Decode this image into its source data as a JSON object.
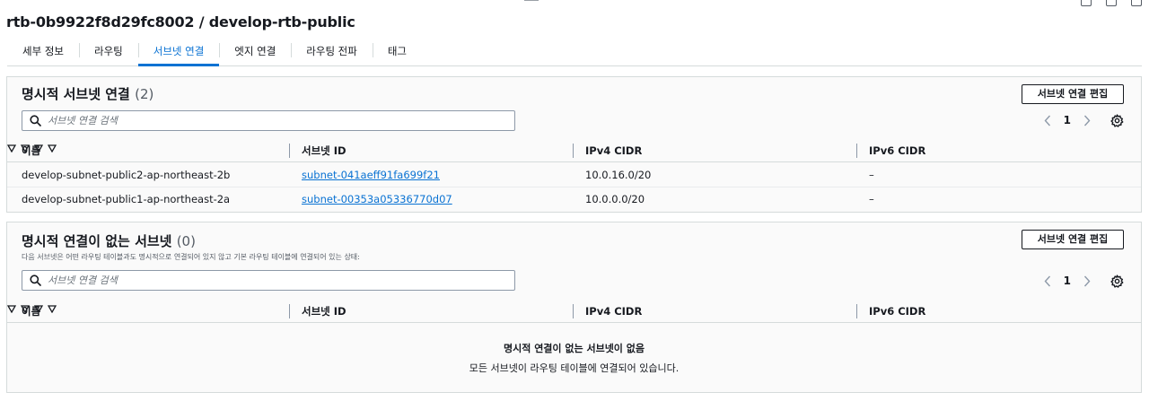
{
  "page": {
    "title": "rtb-0b9922f8d29fc8002 / develop-rtb-public"
  },
  "tabs": [
    {
      "label": "세부 정보"
    },
    {
      "label": "라우팅"
    },
    {
      "label": "서브넷 연결"
    },
    {
      "label": "엣지 연결"
    },
    {
      "label": "라우팅 전파"
    },
    {
      "label": "태그"
    }
  ],
  "explicit": {
    "title": "명시적 서브넷 연결",
    "count": "(2)",
    "edit_label": "서브넷 연결 편집",
    "search_placeholder": "서브넷 연결 검색",
    "page": "1",
    "columns": [
      "이름",
      "서브넷 ID",
      "IPv4 CIDR",
      "IPv6 CIDR"
    ],
    "rows": [
      {
        "name": "develop-subnet-public2-ap-northeast-2b",
        "subnet_id": "subnet-041aeff91fa699f21",
        "ipv4": "10.0.16.0/20",
        "ipv6": "–"
      },
      {
        "name": "develop-subnet-public1-ap-northeast-2a",
        "subnet_id": "subnet-00353a05336770d07",
        "ipv4": "10.0.0.0/20",
        "ipv6": "–"
      }
    ]
  },
  "implicit": {
    "title": "명시적 연결이 없는 서브넷",
    "count": "(0)",
    "description": "다음 서브넷은 어떤 라우팅 테이블과도 명시적으로 연결되어 있지 않고 기본 라우팅 테이블에 연결되어 있는 상태:",
    "edit_label": "서브넷 연결 편집",
    "search_placeholder": "서브넷 연결 검색",
    "page": "1",
    "columns": [
      "이름",
      "서브넷 ID",
      "IPv4 CIDR",
      "IPv6 CIDR"
    ],
    "empty_title": "명시적 연결이 없는 서브넷이 없음",
    "empty_desc": "모든 서브넷이 라우팅 테이블에 연결되어 있습니다."
  },
  "colors": {
    "accent": "#0972d3",
    "text": "#16191f",
    "border": "#d5dbdb"
  }
}
